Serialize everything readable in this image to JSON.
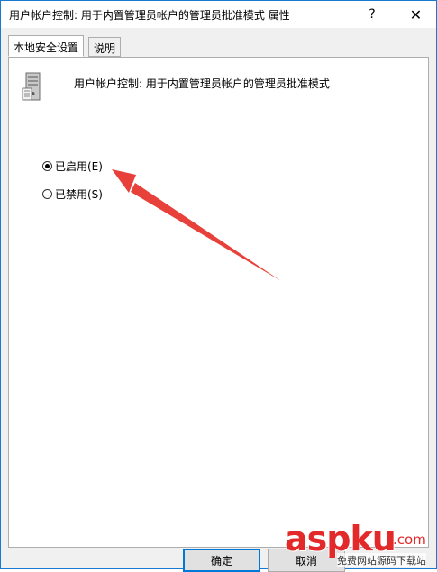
{
  "window": {
    "title": "用户帐户控制: 用于内置管理员帐户的管理员批准模式 属性",
    "help_glyph": "?",
    "close_glyph": "✕"
  },
  "tabs": [
    {
      "label": "本地安全设置",
      "active": true
    },
    {
      "label": "说明",
      "active": false
    }
  ],
  "policy": {
    "icon": "server-policy-icon",
    "title": "用户帐户控制: 用于内置管理员帐户的管理员批准模式"
  },
  "options": [
    {
      "label": "已启用(E)",
      "checked": true
    },
    {
      "label": "已禁用(S)",
      "checked": false
    }
  ],
  "buttons": {
    "ok": "确定",
    "cancel": "取消"
  },
  "annotation": {
    "arrow_color": "#e8403a"
  },
  "watermark": {
    "brand": "aspku",
    "suffix": ".com",
    "tagline": "免费网站源码下载站"
  }
}
